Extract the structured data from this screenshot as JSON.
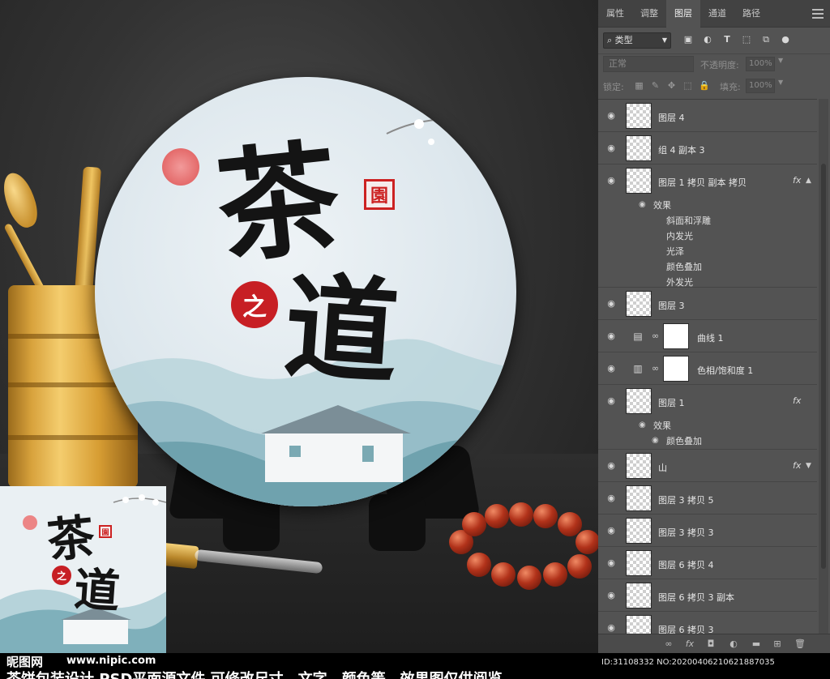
{
  "panel": {
    "tabs": [
      {
        "label": "属性",
        "active": false
      },
      {
        "label": "调整",
        "active": false
      },
      {
        "label": "图层",
        "active": true
      },
      {
        "label": "通道",
        "active": false
      },
      {
        "label": "路径",
        "active": false
      }
    ],
    "filter_kind": "类型",
    "filter_icons": [
      "image-filter-icon",
      "adjustment-filter-icon",
      "type-filter-icon",
      "shape-filter-icon",
      "smart-object-filter-icon",
      "toggle-filter-icon"
    ],
    "blend_mode": "正常",
    "opacity_label": "不透明度:",
    "opacity_value": "100%",
    "lock_label": "锁定:",
    "fill_label": "填充:",
    "fill_value": "100%",
    "layers": [
      {
        "name": "图层 4",
        "type": "pixel",
        "fx": false
      },
      {
        "name": "组 4 副本 3",
        "type": "pixel",
        "fx": false
      },
      {
        "name": "图层 1 拷贝 副本 拷贝",
        "type": "pixel",
        "fx": true,
        "effects_label": "效果",
        "effects": [
          "斜面和浮雕",
          "内发光",
          "光泽",
          "颜色叠加",
          "外发光"
        ]
      },
      {
        "name": "图层 3",
        "type": "pixel",
        "fx": false
      },
      {
        "name": "曲线 1",
        "type": "adjustment",
        "adj_icon": "curves-icon"
      },
      {
        "name": "色相/饱和度 1",
        "type": "adjustment",
        "adj_icon": "hue-saturation-icon"
      },
      {
        "name": "图层 1",
        "type": "pixel",
        "fx": true,
        "effects_label": "效果",
        "effects": [
          "颜色叠加"
        ]
      },
      {
        "name": "山",
        "type": "pixel",
        "fx": true
      },
      {
        "name": "图层 3 拷贝 5",
        "type": "pixel",
        "fx": false
      },
      {
        "name": "图层 3 拷贝 3",
        "type": "pixel",
        "fx": false
      },
      {
        "name": "图层 6 拷贝 4",
        "type": "pixel",
        "fx": false
      },
      {
        "name": "图层 6 拷贝 3 副本",
        "type": "pixel",
        "fx": false
      },
      {
        "name": "图层 6 拷贝 3",
        "type": "pixel",
        "fx": false
      }
    ],
    "fx_label": "fx",
    "footer_icons": [
      "link-layers-icon",
      "fx-icon",
      "mask-icon",
      "adjustment-layer-icon",
      "folder-icon",
      "new-layer-icon",
      "trash-icon"
    ]
  },
  "artwork": {
    "char1": "茶",
    "char2": "道",
    "seal_square": "園",
    "seal_round": "之",
    "colors": {
      "seal_red": "#c71f24",
      "sun": "#e46a6a",
      "mountain": "#8fb9c4",
      "tea_cake": "#dde7ed"
    }
  },
  "watermark": {
    "brand": "昵图网",
    "site": "www.nipic.com",
    "caption": "茶饼包装设计 PSD平面源文件 可修改尺寸、文字、颜色等，效果图仅供阅览",
    "image_id": "ID:31108332 NO:20200406210621887035"
  }
}
